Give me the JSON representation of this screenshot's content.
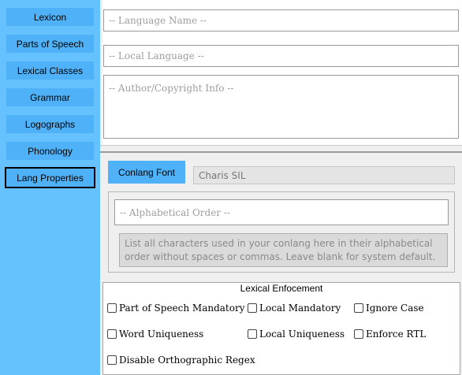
{
  "sidebar": {
    "items": [
      {
        "label": "Lexicon"
      },
      {
        "label": "Parts of Speech"
      },
      {
        "label": "Lexical Classes"
      },
      {
        "label": "Grammar"
      },
      {
        "label": "Logographs"
      },
      {
        "label": "Phonology"
      },
      {
        "label": "Lang Properties",
        "active": true
      }
    ]
  },
  "fields": {
    "language_name_placeholder": "-- Language Name --",
    "local_language_placeholder": "-- Local Language --",
    "author_placeholder": "-- Author/Copyright Info --"
  },
  "font": {
    "button_label": "Conlang Font",
    "value": "Charis SIL"
  },
  "alphabet": {
    "placeholder": "-- Alphabetical Order --",
    "hint": "List all characters used in your conlang here in their alphabetical order without spaces or commas. Leave blank for system default."
  },
  "lexical": {
    "title": "Lexical Enfocement",
    "options": [
      {
        "label": "Part of Speech Mandatory",
        "checked": false
      },
      {
        "label": "Local Mandatory",
        "checked": false
      },
      {
        "label": "Ignore Case",
        "checked": false
      },
      {
        "label": "Word Uniqueness",
        "checked": false
      },
      {
        "label": "Local Uniqueness",
        "checked": false
      },
      {
        "label": "Enforce RTL",
        "checked": false
      },
      {
        "label": "Disable Orthographic Regex",
        "checked": false
      }
    ]
  },
  "colors": {
    "sidebar_bg": "#66c1ff",
    "button_bg": "#4fb1f7"
  }
}
